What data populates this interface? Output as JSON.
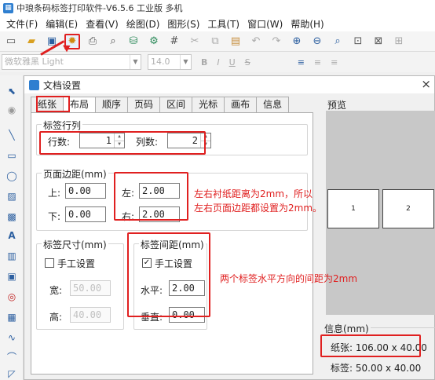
{
  "window": {
    "title": "中琅条码标签打印软件-V6.5.6 工业版 多机"
  },
  "menu": [
    "文件(F)",
    "编辑(E)",
    "查看(V)",
    "绘图(D)",
    "图形(S)",
    "工具(T)",
    "窗口(W)",
    "帮助(H)"
  ],
  "format_toolbar": {
    "font_name": "微软雅黑 Light",
    "font_size": "14.0",
    "buttons": [
      "B",
      "I",
      "U",
      "S"
    ]
  },
  "dialog": {
    "title": "文档设置",
    "close": "×",
    "tabs": [
      "纸张",
      "布局",
      "顺序",
      "页码",
      "区间",
      "光标",
      "画布",
      "信息"
    ],
    "active_tab": "布局",
    "label_rows_cols": {
      "legend": "标签行列",
      "rows_label": "行数:",
      "rows_value": "1",
      "cols_label": "列数:",
      "cols_value": "2"
    },
    "page_margin": {
      "legend": "页面边距(mm)",
      "top_label": "上:",
      "top_value": "0.00",
      "bottom_label": "下:",
      "bottom_value": "0.00",
      "left_label": "左:",
      "left_value": "2.00",
      "right_label": "右:",
      "right_value": "2.00"
    },
    "label_size": {
      "legend": "标签尺寸(mm)",
      "manual_label": "手工设置",
      "manual_checked": false,
      "width_label": "宽:",
      "width_value": "50.00",
      "height_label": "高:",
      "height_value": "40.00"
    },
    "label_spacing": {
      "legend": "标签间距(mm)",
      "manual_label": "手工设置",
      "manual_checked": true,
      "horizontal_label": "水平:",
      "horizontal_value": "2.00",
      "vertical_label": "垂直:",
      "vertical_value": "0.00"
    },
    "preview": {
      "label": "预览",
      "pages": [
        "1",
        "2"
      ]
    },
    "info": {
      "legend": "信息(mm)",
      "paper": "纸张: 106.00 x 40.00",
      "label": "标签: 50.00 x 40.00"
    }
  },
  "annotations": {
    "margin_note_1": "左右衬纸距离为2mm，所以",
    "margin_note_2": "左右页面边距都设置为2mm。",
    "spacing_note": "两个标签水平方向的间距为2mm"
  },
  "colors": {
    "highlight": "#e02020",
    "accent": "#2f7fd0"
  }
}
